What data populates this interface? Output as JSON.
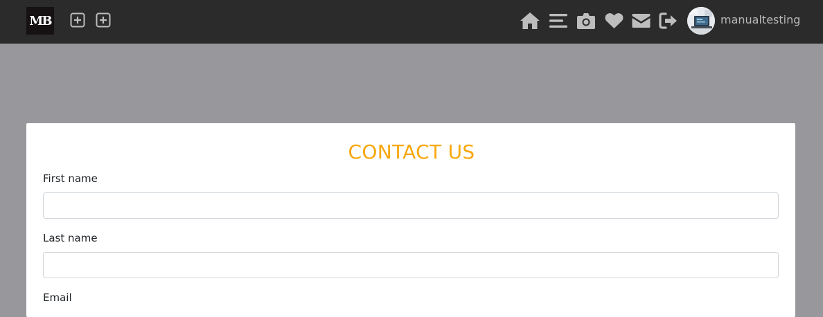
{
  "navbar": {
    "logo_text": "MB",
    "icons": [
      "add-square-icon",
      "add-square-icon",
      "home-icon",
      "menu-icon",
      "camera-icon",
      "heart-icon",
      "envelope-icon",
      "sign-out-icon"
    ],
    "username": "manualtesting",
    "background_color": "#2b2b2b",
    "icon_color": "#bdbdbd"
  },
  "page": {
    "background_color": "#98979c"
  },
  "contact_form": {
    "title": "CONTACT US",
    "title_color": "#f8a70c",
    "fields": [
      {
        "label": "First name",
        "value": "",
        "placeholder": ""
      },
      {
        "label": "Last name",
        "value": "",
        "placeholder": ""
      },
      {
        "label": "Email",
        "value": "",
        "placeholder": ""
      }
    ]
  }
}
